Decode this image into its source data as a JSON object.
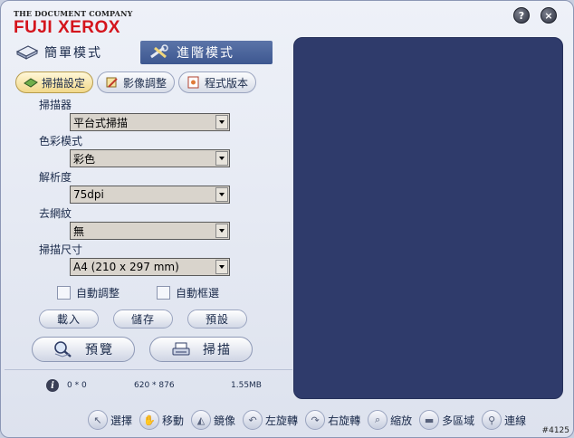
{
  "brand": {
    "company": "THE DOCUMENT COMPANY",
    "name": "FUJI XEROX"
  },
  "titlebar": {
    "help_glyph": "?",
    "close_glyph": "×"
  },
  "modes": {
    "simple_label": "簡單模式",
    "advanced_label": "進階模式"
  },
  "tabs": [
    {
      "label": "掃描設定",
      "icon": "scan-settings-icon",
      "active": true
    },
    {
      "label": "影像調整",
      "icon": "image-adjust-icon",
      "active": false
    },
    {
      "label": "程式版本",
      "icon": "version-icon",
      "active": false
    }
  ],
  "form": {
    "scanner": {
      "label": "掃描器",
      "value": "平台式掃描"
    },
    "color_mode": {
      "label": "色彩模式",
      "value": "彩色"
    },
    "resolution": {
      "label": "解析度",
      "value": "75dpi"
    },
    "descreen": {
      "label": "去網紋",
      "value": "無"
    },
    "scan_size": {
      "label": "掃描尺寸",
      "value": "A4 (210 x 297 mm)"
    },
    "auto_adjust_label": "自動調整",
    "auto_crop_label": "自動框選"
  },
  "buttons": {
    "load": "載入",
    "save": "儲存",
    "default": "預設",
    "preview": "預覽",
    "scan": "掃描"
  },
  "status": {
    "position": "0 * 0",
    "dimensions": "620 * 876",
    "size": "1.55MB"
  },
  "toolbar": [
    {
      "label": "選擇",
      "icon": "select-arrow-icon",
      "glyph": "↖"
    },
    {
      "label": "移動",
      "icon": "hand-move-icon",
      "glyph": "✋"
    },
    {
      "label": "鏡像",
      "icon": "mirror-icon",
      "glyph": "◭"
    },
    {
      "label": "左旋轉",
      "icon": "rotate-left-icon",
      "glyph": "↶"
    },
    {
      "label": "右旋轉",
      "icon": "rotate-right-icon",
      "glyph": "↷"
    },
    {
      "label": "縮放",
      "icon": "zoom-icon",
      "glyph": "⌕"
    },
    {
      "label": "多區域",
      "icon": "multi-region-icon",
      "glyph": "▬"
    },
    {
      "label": "連線",
      "icon": "link-icon",
      "glyph": "⚲"
    }
  ],
  "corner_tag": "#4125"
}
